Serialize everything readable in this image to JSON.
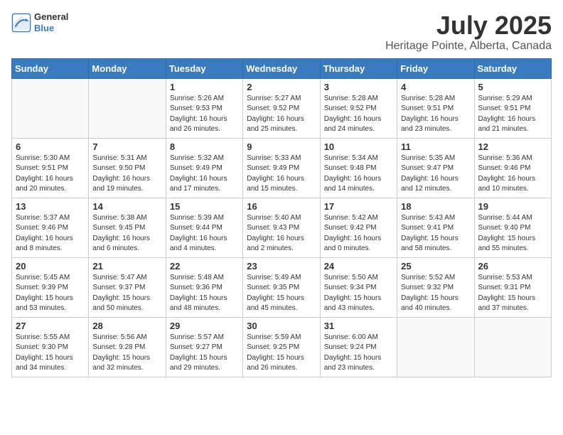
{
  "header": {
    "logo_line1": "General",
    "logo_line2": "Blue",
    "title": "July 2025",
    "subtitle": "Heritage Pointe, Alberta, Canada"
  },
  "weekdays": [
    "Sunday",
    "Monday",
    "Tuesday",
    "Wednesday",
    "Thursday",
    "Friday",
    "Saturday"
  ],
  "weeks": [
    [
      null,
      null,
      {
        "day": 1,
        "sunrise": "5:26 AM",
        "sunset": "9:53 PM",
        "daylight": "16 hours and 26 minutes."
      },
      {
        "day": 2,
        "sunrise": "5:27 AM",
        "sunset": "9:52 PM",
        "daylight": "16 hours and 25 minutes."
      },
      {
        "day": 3,
        "sunrise": "5:28 AM",
        "sunset": "9:52 PM",
        "daylight": "16 hours and 24 minutes."
      },
      {
        "day": 4,
        "sunrise": "5:28 AM",
        "sunset": "9:51 PM",
        "daylight": "16 hours and 23 minutes."
      },
      {
        "day": 5,
        "sunrise": "5:29 AM",
        "sunset": "9:51 PM",
        "daylight": "16 hours and 21 minutes."
      }
    ],
    [
      {
        "day": 6,
        "sunrise": "5:30 AM",
        "sunset": "9:51 PM",
        "daylight": "16 hours and 20 minutes."
      },
      {
        "day": 7,
        "sunrise": "5:31 AM",
        "sunset": "9:50 PM",
        "daylight": "16 hours and 19 minutes."
      },
      {
        "day": 8,
        "sunrise": "5:32 AM",
        "sunset": "9:49 PM",
        "daylight": "16 hours and 17 minutes."
      },
      {
        "day": 9,
        "sunrise": "5:33 AM",
        "sunset": "9:49 PM",
        "daylight": "16 hours and 15 minutes."
      },
      {
        "day": 10,
        "sunrise": "5:34 AM",
        "sunset": "9:48 PM",
        "daylight": "16 hours and 14 minutes."
      },
      {
        "day": 11,
        "sunrise": "5:35 AM",
        "sunset": "9:47 PM",
        "daylight": "16 hours and 12 minutes."
      },
      {
        "day": 12,
        "sunrise": "5:36 AM",
        "sunset": "9:46 PM",
        "daylight": "16 hours and 10 minutes."
      }
    ],
    [
      {
        "day": 13,
        "sunrise": "5:37 AM",
        "sunset": "9:46 PM",
        "daylight": "16 hours and 8 minutes."
      },
      {
        "day": 14,
        "sunrise": "5:38 AM",
        "sunset": "9:45 PM",
        "daylight": "16 hours and 6 minutes."
      },
      {
        "day": 15,
        "sunrise": "5:39 AM",
        "sunset": "9:44 PM",
        "daylight": "16 hours and 4 minutes."
      },
      {
        "day": 16,
        "sunrise": "5:40 AM",
        "sunset": "9:43 PM",
        "daylight": "16 hours and 2 minutes."
      },
      {
        "day": 17,
        "sunrise": "5:42 AM",
        "sunset": "9:42 PM",
        "daylight": "16 hours and 0 minutes."
      },
      {
        "day": 18,
        "sunrise": "5:43 AM",
        "sunset": "9:41 PM",
        "daylight": "15 hours and 58 minutes."
      },
      {
        "day": 19,
        "sunrise": "5:44 AM",
        "sunset": "9:40 PM",
        "daylight": "15 hours and 55 minutes."
      }
    ],
    [
      {
        "day": 20,
        "sunrise": "5:45 AM",
        "sunset": "9:39 PM",
        "daylight": "15 hours and 53 minutes."
      },
      {
        "day": 21,
        "sunrise": "5:47 AM",
        "sunset": "9:37 PM",
        "daylight": "15 hours and 50 minutes."
      },
      {
        "day": 22,
        "sunrise": "5:48 AM",
        "sunset": "9:36 PM",
        "daylight": "15 hours and 48 minutes."
      },
      {
        "day": 23,
        "sunrise": "5:49 AM",
        "sunset": "9:35 PM",
        "daylight": "15 hours and 45 minutes."
      },
      {
        "day": 24,
        "sunrise": "5:50 AM",
        "sunset": "9:34 PM",
        "daylight": "15 hours and 43 minutes."
      },
      {
        "day": 25,
        "sunrise": "5:52 AM",
        "sunset": "9:32 PM",
        "daylight": "15 hours and 40 minutes."
      },
      {
        "day": 26,
        "sunrise": "5:53 AM",
        "sunset": "9:31 PM",
        "daylight": "15 hours and 37 minutes."
      }
    ],
    [
      {
        "day": 27,
        "sunrise": "5:55 AM",
        "sunset": "9:30 PM",
        "daylight": "15 hours and 34 minutes."
      },
      {
        "day": 28,
        "sunrise": "5:56 AM",
        "sunset": "9:28 PM",
        "daylight": "15 hours and 32 minutes."
      },
      {
        "day": 29,
        "sunrise": "5:57 AM",
        "sunset": "9:27 PM",
        "daylight": "15 hours and 29 minutes."
      },
      {
        "day": 30,
        "sunrise": "5:59 AM",
        "sunset": "9:25 PM",
        "daylight": "15 hours and 26 minutes."
      },
      {
        "day": 31,
        "sunrise": "6:00 AM",
        "sunset": "9:24 PM",
        "daylight": "15 hours and 23 minutes."
      },
      null,
      null
    ]
  ]
}
